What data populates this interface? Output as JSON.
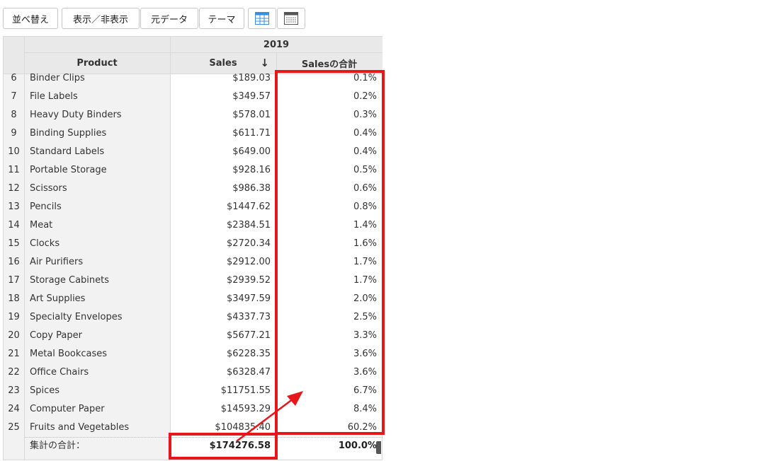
{
  "toolbar": {
    "sort_label": "並べ替え",
    "show_hide_label": "表示／非表示",
    "source_data_label": "元データ",
    "theme_label": "テーマ",
    "table_view_icon": "table-icon",
    "layout_view_icon": "layout-icon"
  },
  "pivot": {
    "year_header": "2019",
    "product_header": "Product",
    "sales_header": "Sales",
    "sort_indicator": "↓",
    "pct_header": "Salesの合計",
    "rows": [
      {
        "n": "6",
        "product": "Binder Clips",
        "sales": "$189.03",
        "pct": "0.1%"
      },
      {
        "n": "7",
        "product": "File Labels",
        "sales": "$349.57",
        "pct": "0.2%"
      },
      {
        "n": "8",
        "product": "Heavy Duty Binders",
        "sales": "$578.01",
        "pct": "0.3%"
      },
      {
        "n": "9",
        "product": "Binding Supplies",
        "sales": "$611.71",
        "pct": "0.4%"
      },
      {
        "n": "10",
        "product": "Standard Labels",
        "sales": "$649.00",
        "pct": "0.4%"
      },
      {
        "n": "11",
        "product": "Portable Storage",
        "sales": "$928.16",
        "pct": "0.5%"
      },
      {
        "n": "12",
        "product": "Scissors",
        "sales": "$986.38",
        "pct": "0.6%"
      },
      {
        "n": "13",
        "product": "Pencils",
        "sales": "$1447.62",
        "pct": "0.8%"
      },
      {
        "n": "14",
        "product": "Meat",
        "sales": "$2384.51",
        "pct": "1.4%"
      },
      {
        "n": "15",
        "product": "Clocks",
        "sales": "$2720.34",
        "pct": "1.6%"
      },
      {
        "n": "16",
        "product": "Air Purifiers",
        "sales": "$2912.00",
        "pct": "1.7%"
      },
      {
        "n": "17",
        "product": "Storage Cabinets",
        "sales": "$2939.52",
        "pct": "1.7%"
      },
      {
        "n": "18",
        "product": "Art Supplies",
        "sales": "$3497.59",
        "pct": "2.0%"
      },
      {
        "n": "19",
        "product": "Specialty Envelopes",
        "sales": "$4337.73",
        "pct": "2.5%"
      },
      {
        "n": "20",
        "product": "Copy Paper",
        "sales": "$5677.21",
        "pct": "3.3%"
      },
      {
        "n": "21",
        "product": "Metal Bookcases",
        "sales": "$6228.35",
        "pct": "3.6%"
      },
      {
        "n": "22",
        "product": "Office Chairs",
        "sales": "$6328.47",
        "pct": "3.6%"
      },
      {
        "n": "23",
        "product": "Spices",
        "sales": "$11751.55",
        "pct": "6.7%"
      },
      {
        "n": "24",
        "product": "Computer Paper",
        "sales": "$14593.29",
        "pct": "8.4%"
      },
      {
        "n": "25",
        "product": "Fruits and Vegetables",
        "sales": "$104835.40",
        "pct": "60.2%"
      }
    ],
    "total_label": "集計の合計：",
    "total_sales": "$174276.58",
    "total_pct": "100.0%"
  },
  "colors": {
    "highlight": "#e8151b",
    "header_bg": "#e9e9e9",
    "row_header_bg": "#f2f2f2",
    "icon_blue": "#3b8fd9"
  }
}
